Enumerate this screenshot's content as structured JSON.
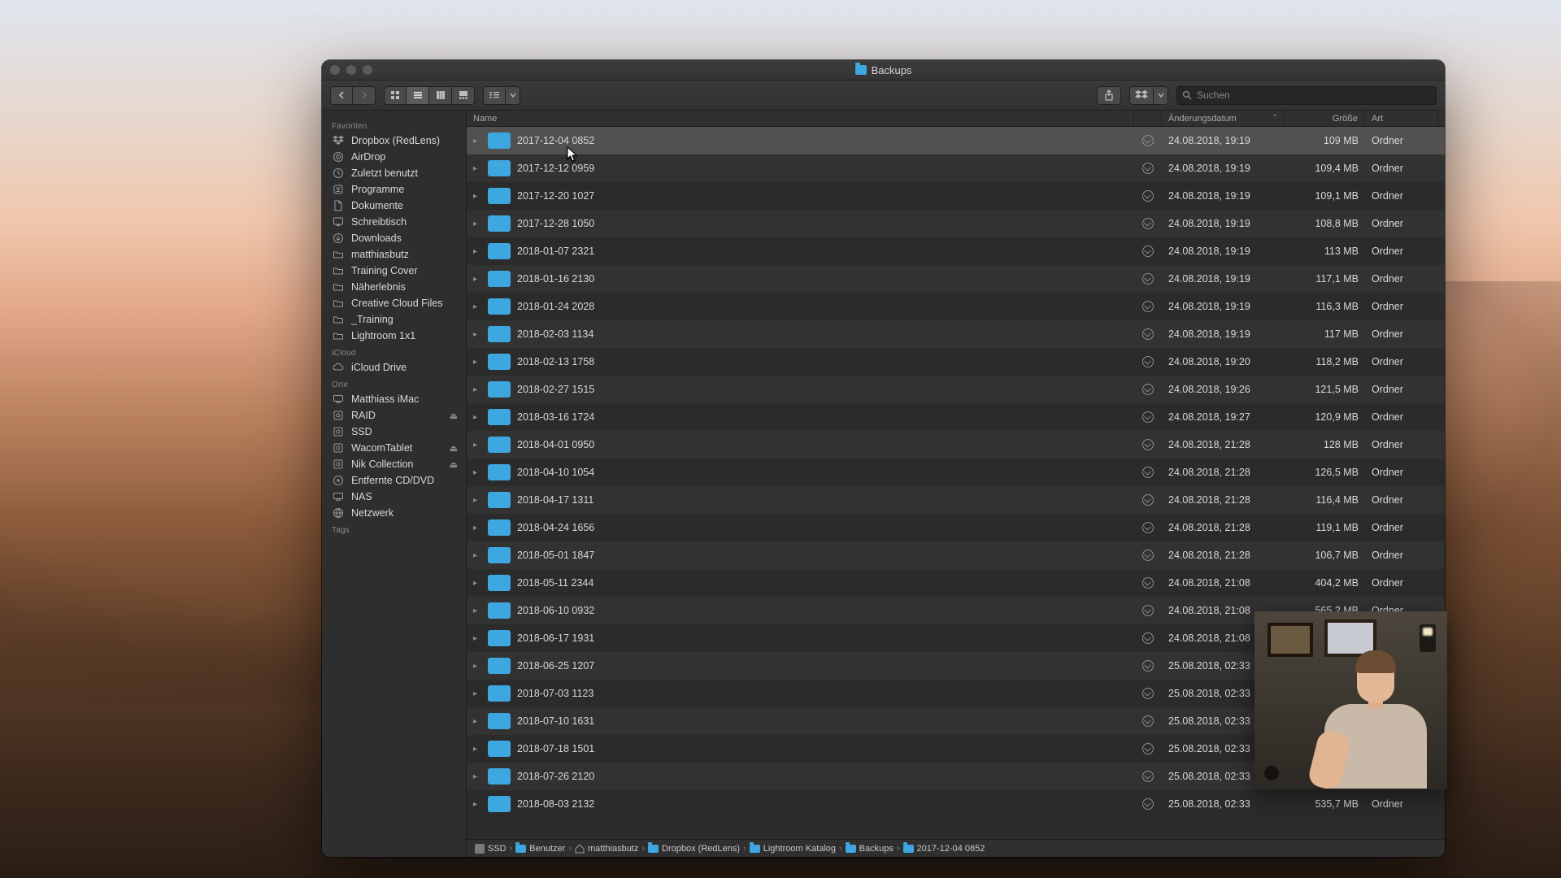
{
  "window": {
    "title": "Backups"
  },
  "search": {
    "placeholder": "Suchen"
  },
  "columns": {
    "name": "Name",
    "modified": "Änderungsdatum",
    "size": "Größe",
    "kind": "Art"
  },
  "sidebar": {
    "sections": [
      {
        "header": "Favoriten",
        "items": [
          {
            "label": "Dropbox (RedLens)",
            "icon": "dropbox",
            "eject": false
          },
          {
            "label": "AirDrop",
            "icon": "airdrop",
            "eject": false
          },
          {
            "label": "Zuletzt benutzt",
            "icon": "clock",
            "eject": false
          },
          {
            "label": "Programme",
            "icon": "app",
            "eject": false
          },
          {
            "label": "Dokumente",
            "icon": "doc",
            "eject": false
          },
          {
            "label": "Schreibtisch",
            "icon": "desktop",
            "eject": false
          },
          {
            "label": "Downloads",
            "icon": "download",
            "eject": false
          },
          {
            "label": "matthiasbutz",
            "icon": "folder",
            "eject": false
          },
          {
            "label": "Training Cover",
            "icon": "folder",
            "eject": false
          },
          {
            "label": "Näherlebnis",
            "icon": "folder",
            "eject": false
          },
          {
            "label": "Creative Cloud Files",
            "icon": "folder",
            "eject": false
          },
          {
            "label": "_Training",
            "icon": "folder",
            "eject": false
          },
          {
            "label": "Lightroom 1x1",
            "icon": "folder",
            "eject": false
          }
        ]
      },
      {
        "header": "iCloud",
        "items": [
          {
            "label": "iCloud Drive",
            "icon": "cloud",
            "eject": false
          }
        ]
      },
      {
        "header": "Orte",
        "items": [
          {
            "label": "Matthiass iMac",
            "icon": "computer",
            "eject": false
          },
          {
            "label": "RAID",
            "icon": "disk",
            "eject": true
          },
          {
            "label": "SSD",
            "icon": "disk",
            "eject": false
          },
          {
            "label": "WacomTablet",
            "icon": "disk",
            "eject": true
          },
          {
            "label": "Nik Collection",
            "icon": "disk",
            "eject": true
          },
          {
            "label": "Entfernte CD/DVD",
            "icon": "disc",
            "eject": false
          },
          {
            "label": "NAS",
            "icon": "computer",
            "eject": false
          },
          {
            "label": "Netzwerk",
            "icon": "globe",
            "eject": false
          }
        ]
      },
      {
        "header": "Tags",
        "items": []
      }
    ]
  },
  "rows": [
    {
      "name": "2017-12-04 0852",
      "modified": "24.08.2018, 19:19",
      "size": "109 MB",
      "kind": "Ordner",
      "selected": true
    },
    {
      "name": "2017-12-12 0959",
      "modified": "24.08.2018, 19:19",
      "size": "109,4 MB",
      "kind": "Ordner",
      "selected": false
    },
    {
      "name": "2017-12-20 1027",
      "modified": "24.08.2018, 19:19",
      "size": "109,1 MB",
      "kind": "Ordner",
      "selected": false
    },
    {
      "name": "2017-12-28 1050",
      "modified": "24.08.2018, 19:19",
      "size": "108,8 MB",
      "kind": "Ordner",
      "selected": false
    },
    {
      "name": "2018-01-07 2321",
      "modified": "24.08.2018, 19:19",
      "size": "113 MB",
      "kind": "Ordner",
      "selected": false
    },
    {
      "name": "2018-01-16 2130",
      "modified": "24.08.2018, 19:19",
      "size": "117,1 MB",
      "kind": "Ordner",
      "selected": false
    },
    {
      "name": "2018-01-24 2028",
      "modified": "24.08.2018, 19:19",
      "size": "116,3 MB",
      "kind": "Ordner",
      "selected": false
    },
    {
      "name": "2018-02-03 1134",
      "modified": "24.08.2018, 19:19",
      "size": "117 MB",
      "kind": "Ordner",
      "selected": false
    },
    {
      "name": "2018-02-13 1758",
      "modified": "24.08.2018, 19:20",
      "size": "118,2 MB",
      "kind": "Ordner",
      "selected": false
    },
    {
      "name": "2018-02-27 1515",
      "modified": "24.08.2018, 19:26",
      "size": "121,5 MB",
      "kind": "Ordner",
      "selected": false
    },
    {
      "name": "2018-03-16 1724",
      "modified": "24.08.2018, 19:27",
      "size": "120,9 MB",
      "kind": "Ordner",
      "selected": false
    },
    {
      "name": "2018-04-01 0950",
      "modified": "24.08.2018, 21:28",
      "size": "128 MB",
      "kind": "Ordner",
      "selected": false
    },
    {
      "name": "2018-04-10 1054",
      "modified": "24.08.2018, 21:28",
      "size": "126,5 MB",
      "kind": "Ordner",
      "selected": false
    },
    {
      "name": "2018-04-17 1311",
      "modified": "24.08.2018, 21:28",
      "size": "116,4 MB",
      "kind": "Ordner",
      "selected": false
    },
    {
      "name": "2018-04-24 1656",
      "modified": "24.08.2018, 21:28",
      "size": "119,1 MB",
      "kind": "Ordner",
      "selected": false
    },
    {
      "name": "2018-05-01 1847",
      "modified": "24.08.2018, 21:28",
      "size": "106,7 MB",
      "kind": "Ordner",
      "selected": false
    },
    {
      "name": "2018-05-11 2344",
      "modified": "24.08.2018, 21:08",
      "size": "404,2 MB",
      "kind": "Ordner",
      "selected": false
    },
    {
      "name": "2018-06-10 0932",
      "modified": "24.08.2018, 21:08",
      "size": "565,2 MB",
      "kind": "Ordner",
      "selected": false
    },
    {
      "name": "2018-06-17 1931",
      "modified": "24.08.2018, 21:08",
      "size": "",
      "kind": "",
      "selected": false
    },
    {
      "name": "2018-06-25 1207",
      "modified": "25.08.2018, 02:33",
      "size": "",
      "kind": "",
      "selected": false
    },
    {
      "name": "2018-07-03 1123",
      "modified": "25.08.2018, 02:33",
      "size": "",
      "kind": "",
      "selected": false
    },
    {
      "name": "2018-07-10 1631",
      "modified": "25.08.2018, 02:33",
      "size": "",
      "kind": "",
      "selected": false
    },
    {
      "name": "2018-07-18 1501",
      "modified": "25.08.2018, 02:33",
      "size": "",
      "kind": "",
      "selected": false
    },
    {
      "name": "2018-07-26 2120",
      "modified": "25.08.2018, 02:33",
      "size": "",
      "kind": "",
      "selected": false
    },
    {
      "name": "2018-08-03 2132",
      "modified": "25.08.2018, 02:33",
      "size": "535,7 MB",
      "kind": "Ordner",
      "selected": false
    }
  ],
  "path": [
    {
      "label": "SSD",
      "icon": "disk"
    },
    {
      "label": "Benutzer",
      "icon": "folder"
    },
    {
      "label": "matthiasbutz",
      "icon": "home"
    },
    {
      "label": "Dropbox (RedLens)",
      "icon": "folder"
    },
    {
      "label": "Lightroom Katalog",
      "icon": "folder"
    },
    {
      "label": "Backups",
      "icon": "folder"
    },
    {
      "label": "2017-12-04 0852",
      "icon": "folder"
    }
  ]
}
